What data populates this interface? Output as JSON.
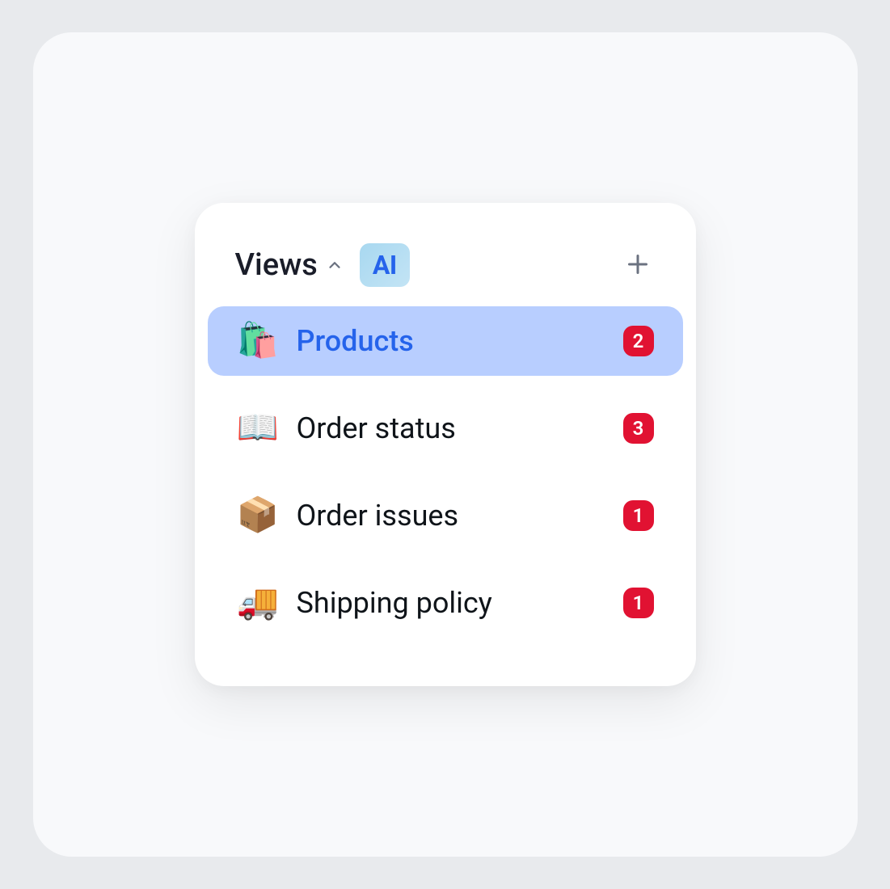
{
  "header": {
    "title": "Views",
    "ai_badge": "AI"
  },
  "views": [
    {
      "icon": "🛍️",
      "label": "Products",
      "count": "2",
      "active": true
    },
    {
      "icon": "📖",
      "label": "Order status",
      "count": "3",
      "active": false
    },
    {
      "icon": "📦",
      "label": "Order issues",
      "count": "1",
      "active": false
    },
    {
      "icon": "🚚",
      "label": "Shipping policy",
      "count": "1",
      "active": false
    }
  ]
}
